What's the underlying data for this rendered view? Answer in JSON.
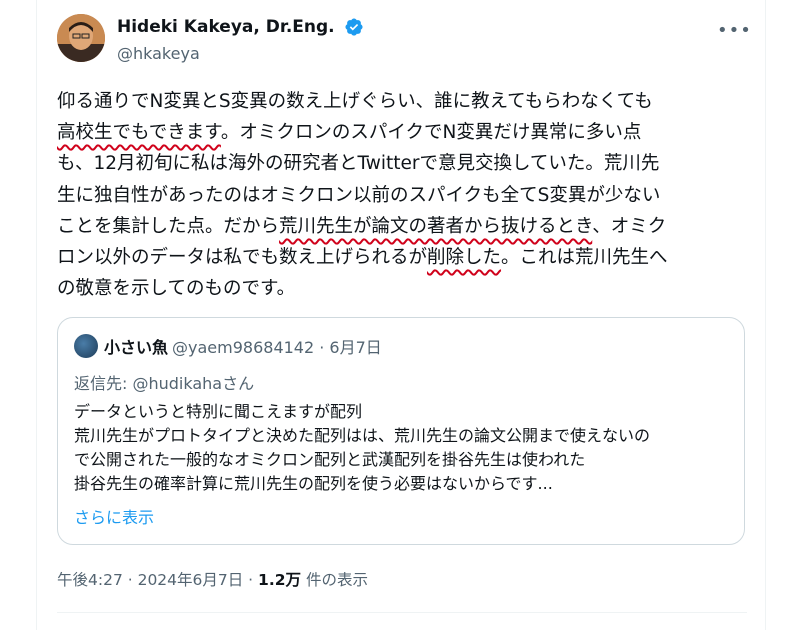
{
  "author": {
    "display_name": "Hideki Kakeya, Dr.Eng.",
    "handle": "@hkakeya",
    "verified_icon": "verified-badge-icon",
    "more_icon": "more-options-icon"
  },
  "tweet": {
    "line1": "仰る通りでN変異とS変異の数え上げぐらい、誰に教えてもらわなくても",
    "line2_a": "高校生でもできます",
    "line2_b": "。オミクロンのスパイクでN変異だけ異常に多い点",
    "line3": "も、12月初旬に私は海外の研究者とTwitterで意見交換していた。荒川先",
    "line4": "生に独自性があったのはオミクロン以前のスパイクも全てS変異が少ない",
    "line5_a": "ことを集計した点。だから",
    "line5_b": "荒川先生が論文の著者から抜けるとき",
    "line5_c": "、オミク",
    "line6_a": "ロン以外のデータは私でも数え上げられるが",
    "line6_b": "削除した",
    "line6_c": "。これは荒川先生へ",
    "line7": "の敬意を示してのものです。",
    "underline_color": "#d0021b"
  },
  "quote": {
    "display_name": "小さい魚",
    "handle_date": "@yaem98684142 · 6月7日",
    "replying_to": "返信先: @hudikahaさん",
    "lines": [
      "データというと特別に聞こえますが配列",
      "荒川先生がプロトタイプと決めた配列はは、荒川先生の論文公開まで使えないの",
      "で公開された一般的なオミクロン配列と武漢配列を掛谷先生は使われた",
      "掛谷先生の確率計算に荒川先生の配列を使う必要はないからです..."
    ],
    "show_more": "さらに表示"
  },
  "meta": {
    "time_date": "午後4:27 · 2024年6月7日 · ",
    "views": "1.2万",
    "views_label": " 件の表示"
  },
  "colors": {
    "link": "#1d9bf0",
    "secondary_text": "#536471",
    "verified": "#1d9bf0"
  }
}
